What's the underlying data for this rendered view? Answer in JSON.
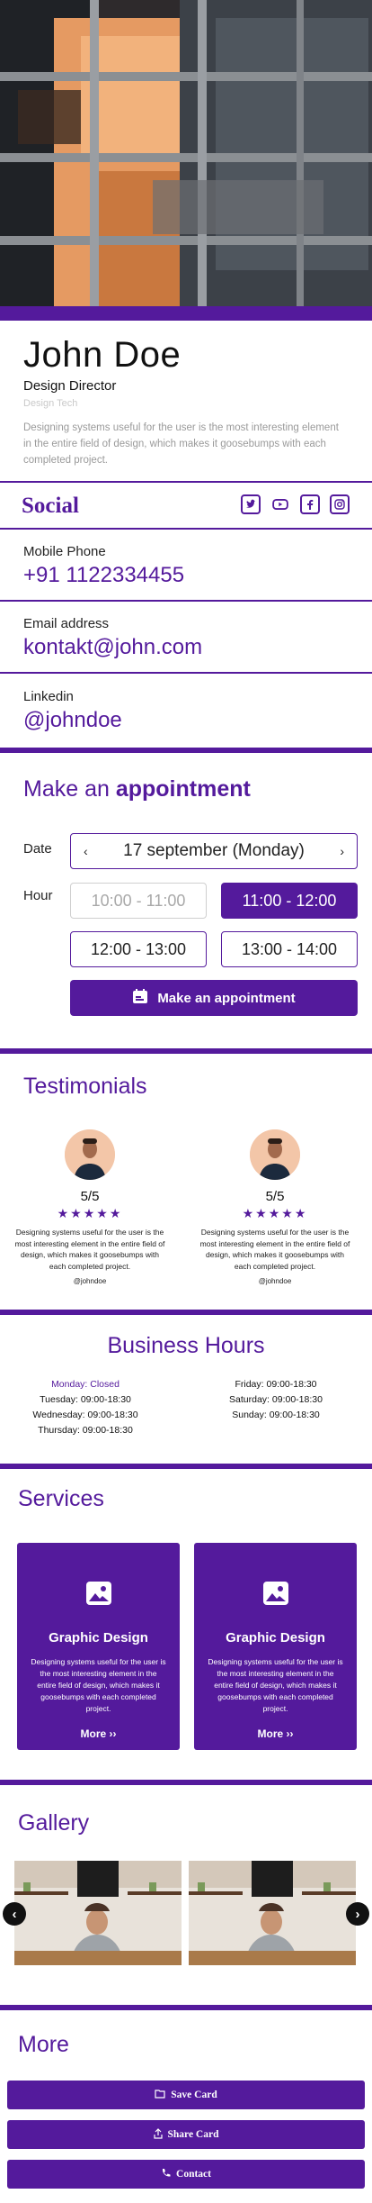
{
  "profile": {
    "name": "John Doe",
    "role": "Design Director",
    "company": "Design Tech",
    "bio": "Designing systems useful for the user is the most interesting element in the entire field of design, which makes it goosebumps with each completed project."
  },
  "social": {
    "title": "Social",
    "icons": [
      "twitter-icon",
      "youtube-icon",
      "facebook-icon",
      "instagram-icon"
    ]
  },
  "contacts": {
    "phone_label": "Mobile Phone",
    "phone_value": "+91 1122334455",
    "email_label": "Email address",
    "email_value": "kontakt@john.com",
    "linkedin_label": "Linkedin",
    "linkedin_value": "@johndoe"
  },
  "appointment": {
    "title_prefix": "Make an ",
    "title_strong": "appointment",
    "date_label": "Date",
    "date_prev": "‹",
    "date_value": "17 september",
    "date_day": "(Monday)",
    "date_next": "›",
    "hour_label": "Hour",
    "slots": [
      "10:00 - 11:00",
      "11:00 - 12:00",
      "12:00 - 13:00",
      "13:00 - 14:00"
    ],
    "button_label": "Make an appointment"
  },
  "testimonials": {
    "title": "Testimonials",
    "items": [
      {
        "score": "5/5",
        "stars": "★★★★★",
        "quote": "Designing systems useful for the user is the most interesting element in the entire field of design, which makes it goosebumps with each completed project.",
        "handle": "@johndoe"
      },
      {
        "score": "5/5",
        "stars": "★★★★★",
        "quote": "Designing systems useful for the user is the most interesting element in the entire field of design, which makes it goosebumps with each completed project.",
        "handle": "@johndoe"
      }
    ]
  },
  "business_hours": {
    "title": "Business Hours",
    "left": [
      "Monday: Closed",
      "Tuesday: 09:00-18:30",
      "Wednesday: 09:00-18:30",
      "Thursday: 09:00-18:30"
    ],
    "right": [
      "Friday: 09:00-18:30",
      "Saturday: 09:00-18:30",
      "Sunday: 09:00-18:30"
    ]
  },
  "services": {
    "title": "Services",
    "items": [
      {
        "title": "Graphic Design",
        "desc": "Designing systems useful for the user is the most interesting element in the entire field of design, which makes it goosebumps with each completed project.",
        "more": "More ››"
      },
      {
        "title": "Graphic Design",
        "desc": "Designing systems useful for the user is the most interesting element in the entire field of design, which makes it goosebumps with each completed project.",
        "more": "More ››"
      }
    ]
  },
  "gallery": {
    "title": "Gallery",
    "prev": "‹",
    "next": "›"
  },
  "more": {
    "title": "More",
    "save": "Save Card",
    "share": "Share Card",
    "contact": "Contact"
  },
  "colors": {
    "accent": "#541a9c"
  }
}
